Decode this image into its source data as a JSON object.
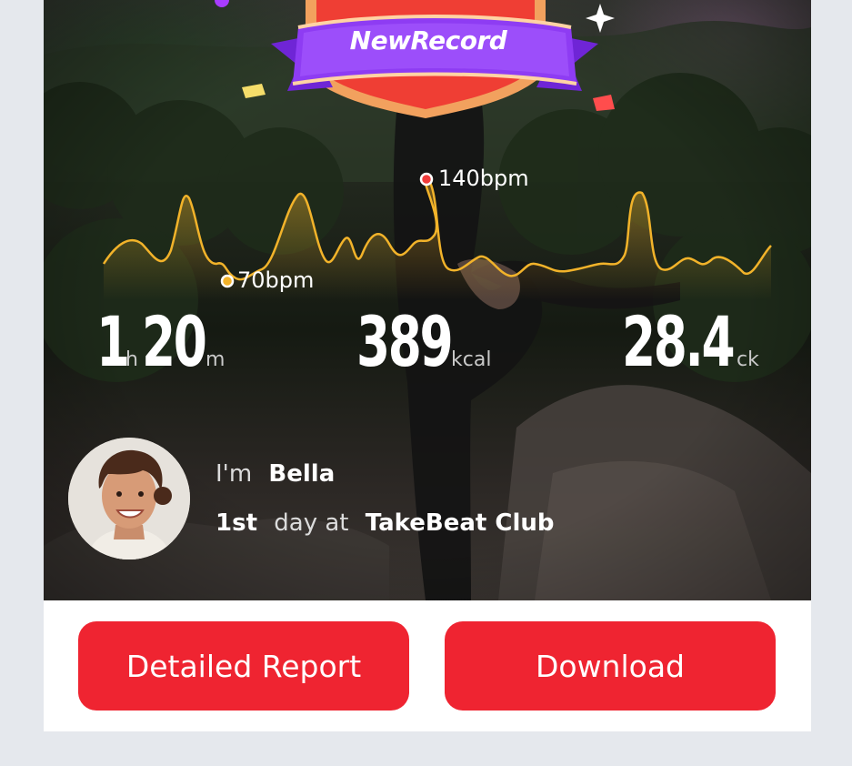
{
  "badge": {
    "text": "NewRecord"
  },
  "heart_chart": {
    "max_label": "140bpm",
    "min_label": "70bpm"
  },
  "stats": {
    "duration_hours": "1",
    "hours_unit": "h",
    "duration_minutes": "20",
    "minutes_unit": "m",
    "calories": "389",
    "calories_unit": "kcal",
    "third_value": "28.4",
    "third_unit": "ck"
  },
  "profile": {
    "im_text": "I'm",
    "name": "Bella",
    "day": "1st",
    "day_text": "day at",
    "club": "TakeBeat Club"
  },
  "actions": {
    "report_label": "Detailed Report",
    "download_label": "Download"
  },
  "colors": {
    "accent": "#ef2431",
    "chart_line": "#f2b32a",
    "page_bg": "#e5e8ed"
  }
}
